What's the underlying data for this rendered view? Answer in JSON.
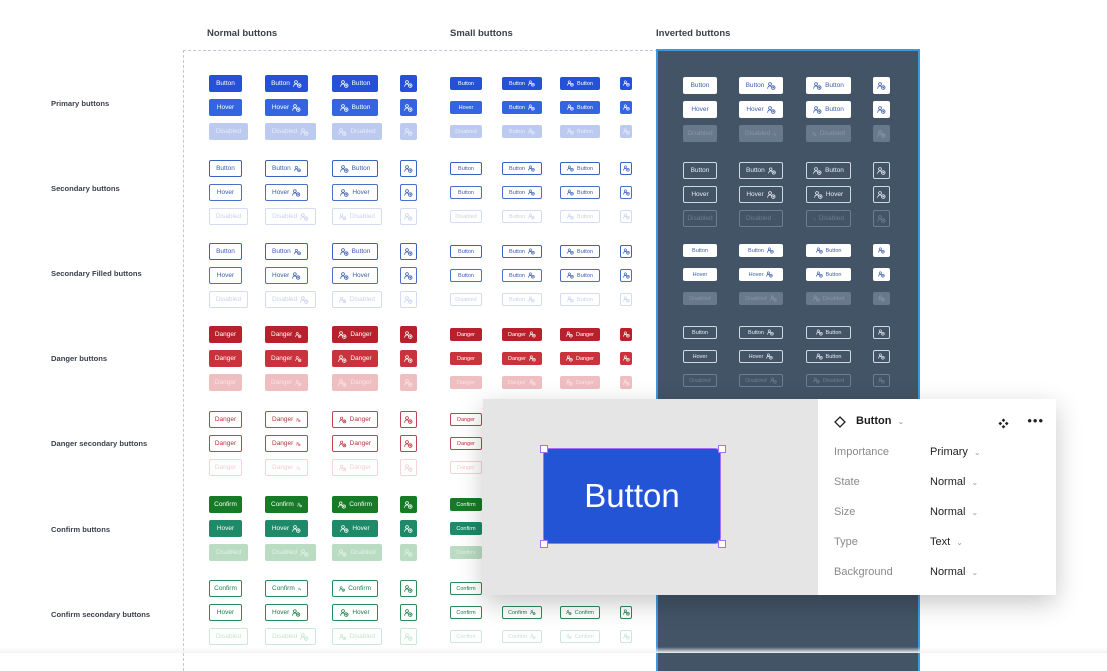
{
  "columns": {
    "normal": "Normal buttons",
    "small": "Small buttons",
    "inverted": "Inverted buttons"
  },
  "rows": [
    {
      "label": "Primary buttons"
    },
    {
      "label": "Secondary buttons"
    },
    {
      "label": "Secondary Filled buttons"
    },
    {
      "label": "Danger buttons"
    },
    {
      "label": "Danger secondary buttons"
    },
    {
      "label": "Confirm buttons"
    },
    {
      "label": "Confirm secondary buttons"
    }
  ],
  "icon_semantic": "user-add-icon",
  "labels": {
    "button": "Button",
    "hover": "Hover",
    "disabled": "Disabled",
    "danger": "Danger",
    "confirm": "Confirm"
  },
  "colors": {
    "primary": "#2551d6",
    "danger": "#b8212c",
    "confirm": "#167a26",
    "inverted_bg": "#435467",
    "selection": "#a86ef5"
  },
  "preview": {
    "button_label": "Button"
  },
  "properties_panel": {
    "component_name": "Button",
    "properties": [
      {
        "label": "Importance",
        "value": "Primary"
      },
      {
        "label": "State",
        "value": "Normal"
      },
      {
        "label": "Size",
        "value": "Normal"
      },
      {
        "label": "Type",
        "value": "Text"
      },
      {
        "label": "Background",
        "value": "Normal"
      }
    ]
  }
}
